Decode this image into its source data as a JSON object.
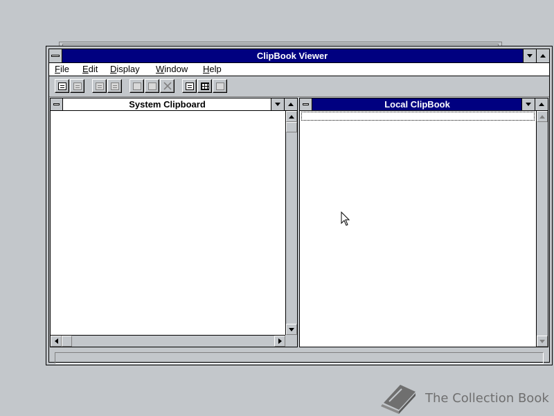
{
  "window": {
    "title": "ClipBook Viewer"
  },
  "menu": {
    "items": [
      {
        "label": "File",
        "accel": "F",
        "rest": "ile"
      },
      {
        "label": "Edit",
        "accel": "E",
        "rest": "dit"
      },
      {
        "label": "Display",
        "accel": "D",
        "rest": "isplay"
      },
      {
        "label": "Window",
        "accel": "W",
        "rest": "indow"
      },
      {
        "label": "Help",
        "accel": "H",
        "rest": "elp"
      }
    ]
  },
  "toolbar": {
    "buttons": [
      {
        "name": "connect-icon",
        "enabled": true
      },
      {
        "name": "disconnect-icon",
        "enabled": false
      },
      {
        "name": "share-icon",
        "enabled": false
      },
      {
        "name": "stop-sharing-icon",
        "enabled": false
      },
      {
        "name": "copy-icon",
        "enabled": false
      },
      {
        "name": "paste-icon",
        "enabled": false
      },
      {
        "name": "delete-icon",
        "enabled": false
      },
      {
        "name": "table-of-contents-icon",
        "enabled": true
      },
      {
        "name": "thumbnails-icon",
        "enabled": true
      },
      {
        "name": "full-page-icon",
        "enabled": false
      }
    ]
  },
  "panes": {
    "system_clipboard": {
      "title": "System Clipboard"
    },
    "local_clipbook": {
      "title": "Local ClipBook"
    }
  },
  "statusbar": {
    "text": ""
  },
  "watermark": {
    "text": "The Collection Book"
  },
  "colors": {
    "desktop": "#c3c7cb",
    "titlebar_active": "#000080",
    "window_bg": "#ffffff"
  }
}
